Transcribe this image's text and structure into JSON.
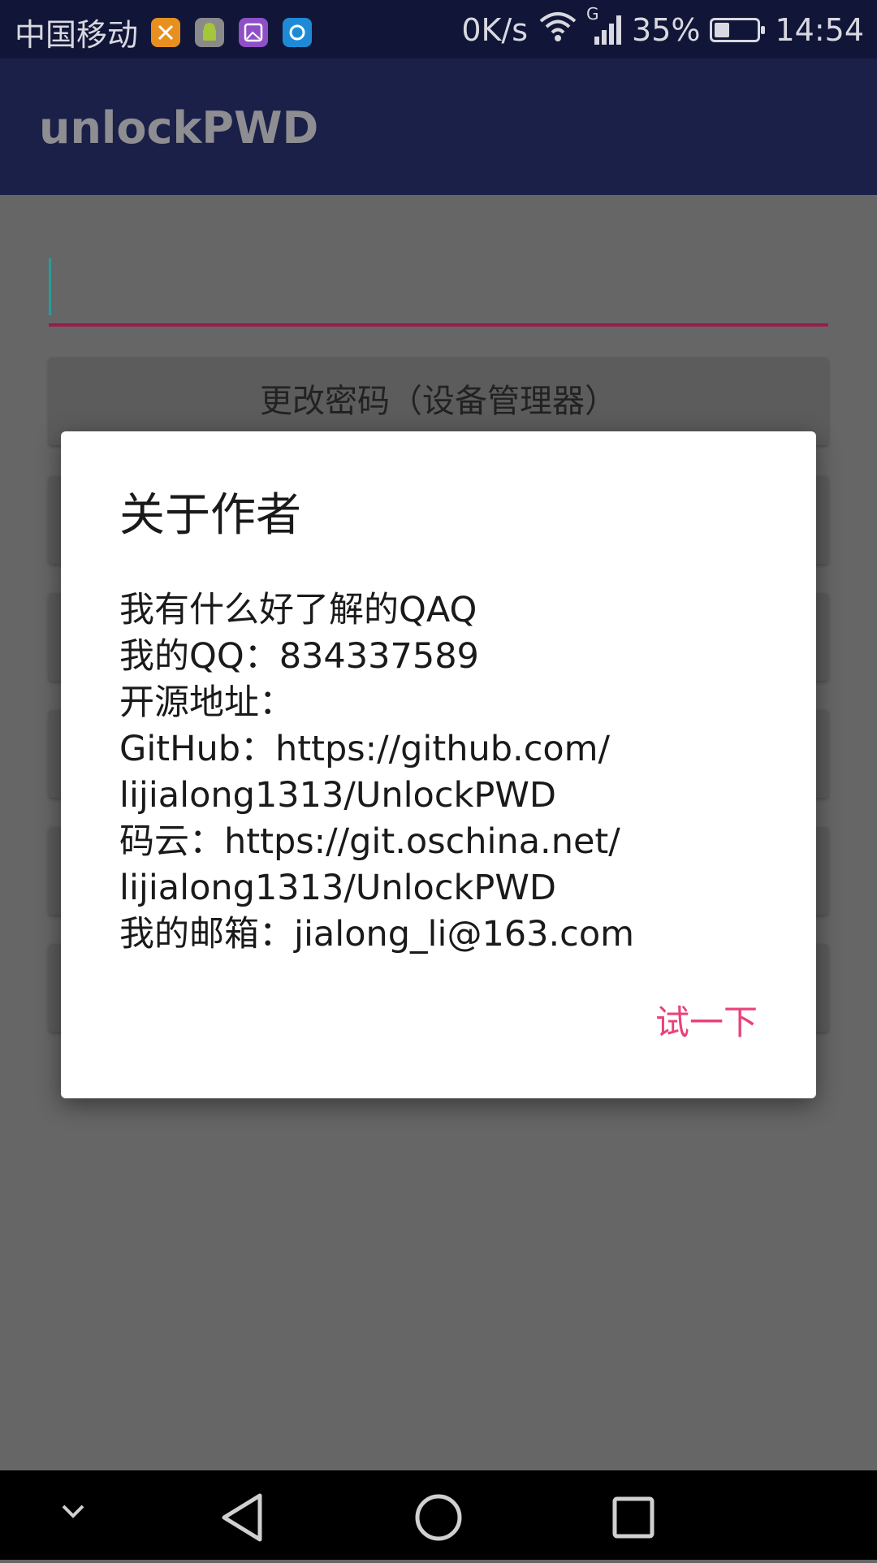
{
  "status_bar": {
    "carrier": "中国移动",
    "net_speed": "0K/s",
    "signal_type": "G",
    "battery_percent": "35%",
    "battery_level": 0.35,
    "time": "14:54",
    "notification_icons": [
      "photo-app-icon",
      "android-icon",
      "gallery-icon",
      "circle-app-icon"
    ]
  },
  "toolbar": {
    "title": "unlockPWD"
  },
  "main": {
    "password_input_value": "",
    "change_password_button": "更改密码（设备管理器）"
  },
  "dialog": {
    "title": "关于作者",
    "message_lines": [
      "我有什么好了解的QAQ",
      "我的QQ：834337589",
      "开源地址：",
      "GitHub：https://github.com/",
      "lijialong1313/UnlockPWD",
      "码云：https://git.oschina.net/",
      "lijialong1313/UnlockPWD",
      "我的邮箱：jialong_li@163.com"
    ],
    "positive_button": "试一下"
  },
  "colors": {
    "status_bar_bg": "#111638",
    "toolbar_bg": "#1a2048",
    "accent": "#e8427a",
    "dim_background": "#666666"
  }
}
